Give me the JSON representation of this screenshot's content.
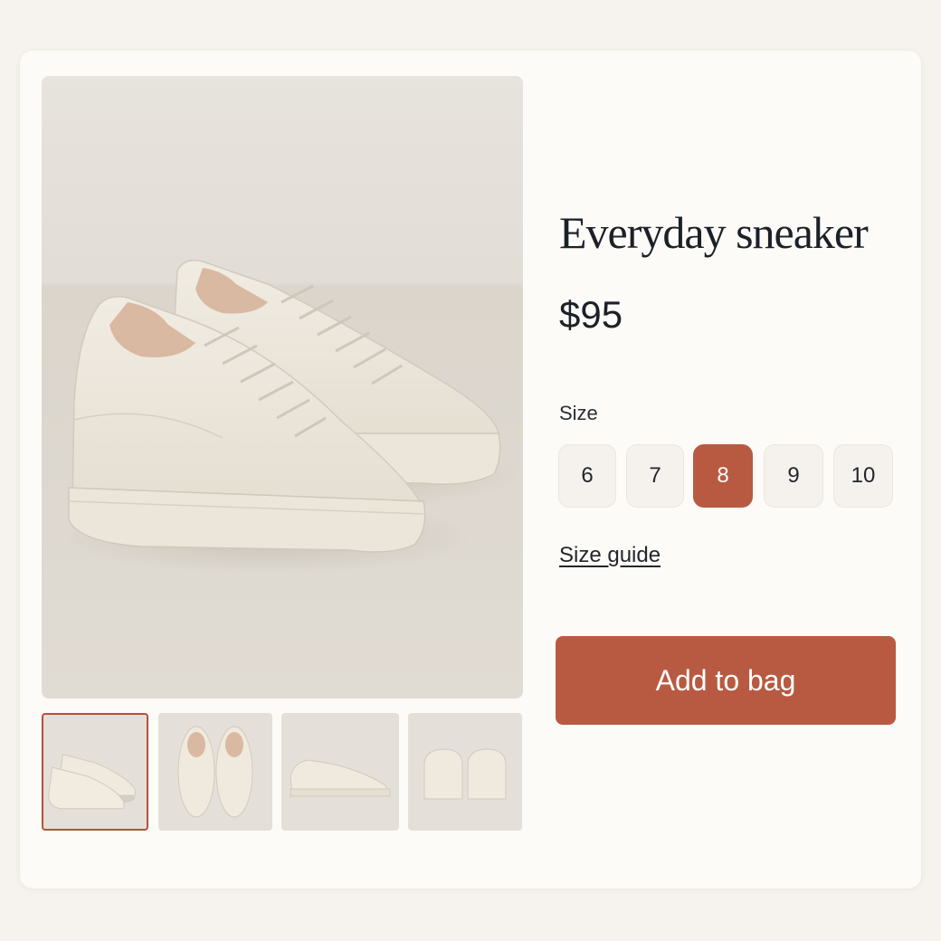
{
  "product": {
    "title": "Everyday sneaker",
    "price": "$95"
  },
  "size_selector": {
    "label": "Size",
    "options": [
      "6",
      "7",
      "8",
      "9",
      "10"
    ],
    "selected": "8"
  },
  "size_guide_label": "Size guide",
  "add_to_bag_label": "Add to bag",
  "gallery": {
    "main_image": "sneaker-pair-three-quarter-photo",
    "thumbnails": [
      "sneaker-pair-three-quarter-thumb",
      "sneaker-pair-top-view-thumb",
      "sneaker-side-view-thumb",
      "sneaker-back-view-thumb"
    ],
    "selected_index": 0
  },
  "colors": {
    "accent": "#b85a41",
    "page_background": "#f6f3ee",
    "card_background": "#fcfbf8",
    "text": "#1c2128"
  }
}
